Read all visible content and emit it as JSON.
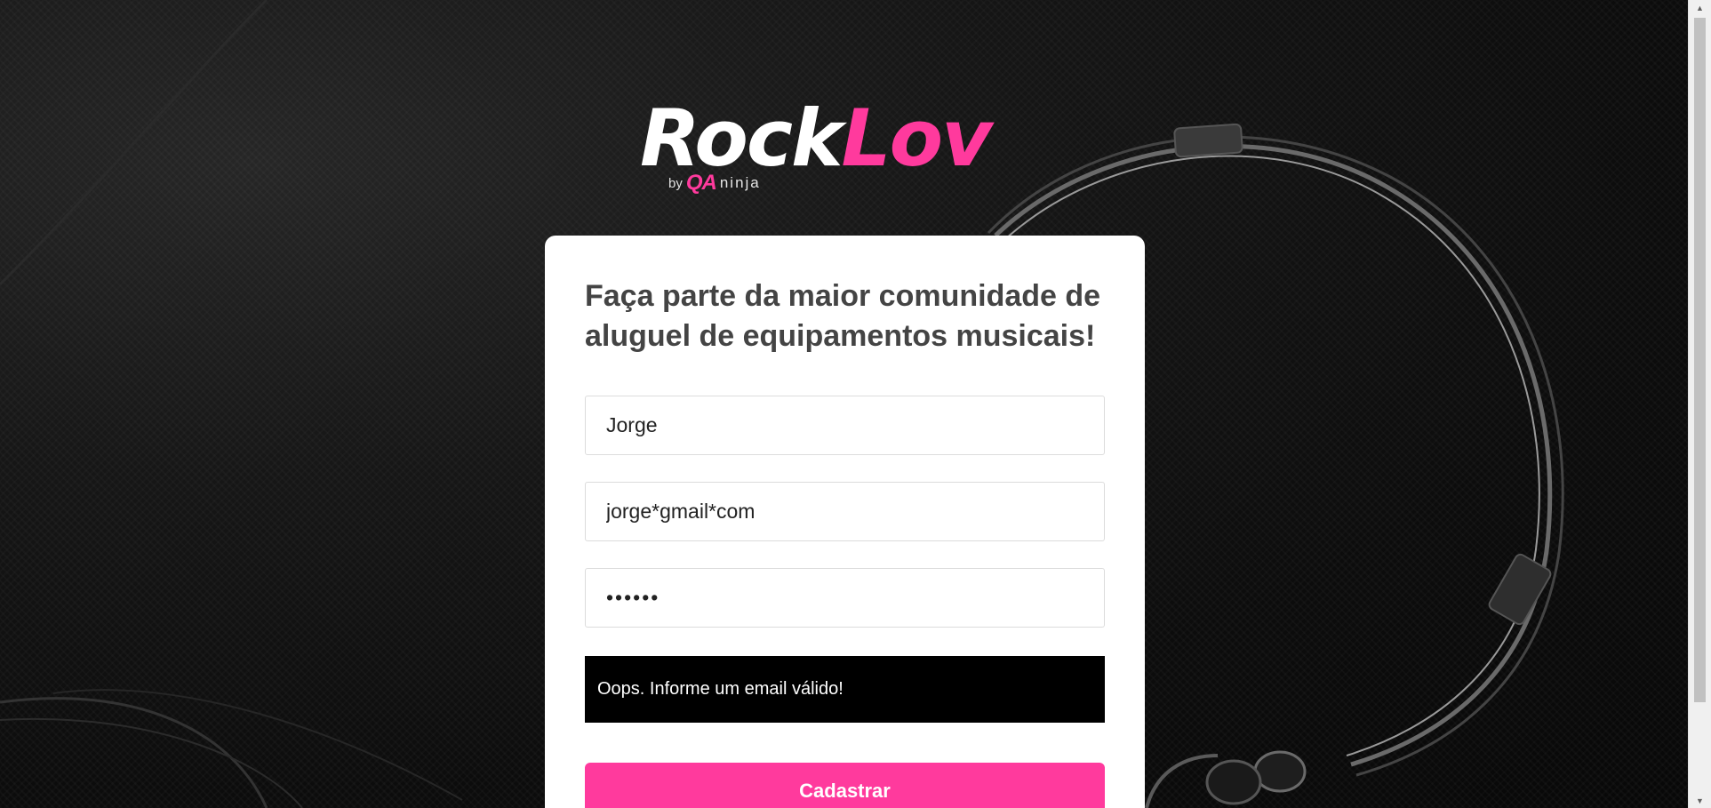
{
  "logo": {
    "rock": "Rock",
    "lov": "Lov",
    "by": "by",
    "qa": "QA",
    "ninja": "ninja"
  },
  "form": {
    "headline": "Faça parte da maior comunidade de aluguel de equipamentos musicais!",
    "name_value": "Jorge",
    "email_value": "jorge*gmail*com",
    "password_value": "••••••",
    "alert_text": "Oops. Informe um email válido!",
    "submit_label": "Cadastrar"
  },
  "colors": {
    "brand_pink": "#ff3a9d",
    "card_bg": "#ffffff",
    "alert_bg": "#000000",
    "headline": "#444444"
  },
  "icons": {
    "scroll_up": "arrow-up-icon",
    "scroll_down": "arrow-down-icon"
  }
}
